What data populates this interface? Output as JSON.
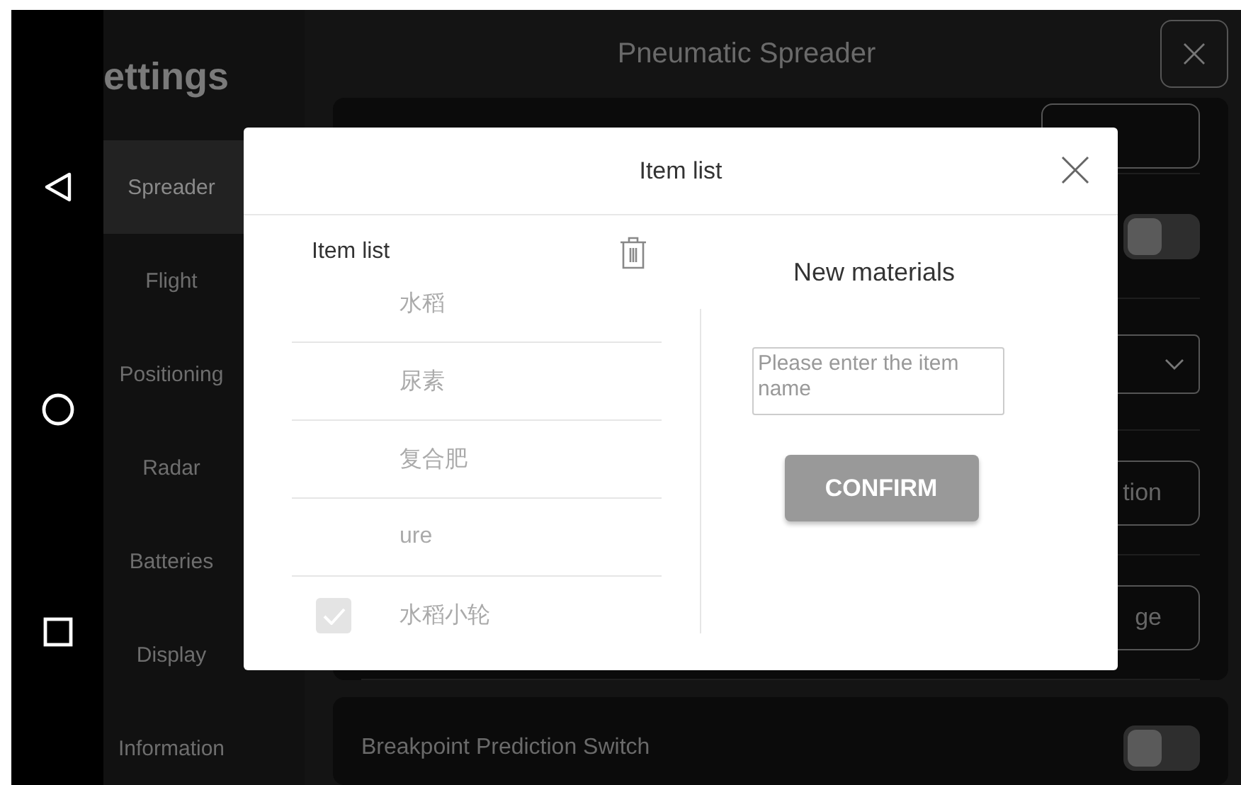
{
  "sidebar": {
    "title": "ettings",
    "items": [
      {
        "label": "Spreader",
        "selected": true
      },
      {
        "label": "Flight",
        "selected": false
      },
      {
        "label": "Positioning",
        "selected": false
      },
      {
        "label": "Radar",
        "selected": false
      },
      {
        "label": "Batteries",
        "selected": false
      },
      {
        "label": "Display",
        "selected": false
      },
      {
        "label": "Information",
        "selected": false
      }
    ]
  },
  "header": {
    "title": "Pneumatic Spreader"
  },
  "settings_rows": [
    {
      "kind": "button"
    },
    {
      "kind": "toggle",
      "on": false
    },
    {
      "kind": "dropdown"
    },
    {
      "kind": "button",
      "label": "tion"
    },
    {
      "kind": "button",
      "label": "ge"
    }
  ],
  "breakpoint_card": {
    "label": "Breakpoint Prediction Switch",
    "on": false
  },
  "dialog": {
    "title": "Item list",
    "list_title": "Item list",
    "items": [
      {
        "name": "水稻",
        "checked": false
      },
      {
        "name": "尿素",
        "checked": false
      },
      {
        "name": "复合肥",
        "checked": false
      },
      {
        "name": "ure",
        "checked": false
      },
      {
        "name": "水稻小轮",
        "checked": true
      }
    ],
    "new_title": "New materials",
    "placeholder": "Please enter the item name",
    "confirm": "CONFIRM"
  }
}
